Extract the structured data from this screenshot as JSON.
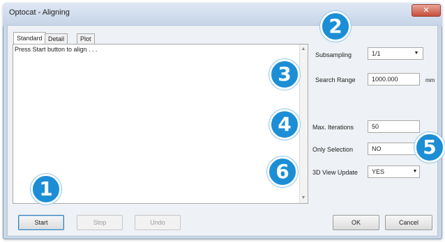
{
  "window": {
    "title": "Optocat - Aligning",
    "close_glyph": "✕"
  },
  "tabs": [
    {
      "label": "Standard",
      "active": true
    },
    {
      "label": "Detail",
      "active": false
    },
    {
      "label": "Plot",
      "active": false
    }
  ],
  "output": {
    "text": "Press Start button to align . . ."
  },
  "form": {
    "subsampling": {
      "label": "Subsampling",
      "value": "1/1"
    },
    "search_range": {
      "label": "Search Range",
      "value": "1000.000",
      "unit": "mm"
    },
    "max_iterations": {
      "label": "Max. Iterations",
      "value": "50"
    },
    "only_selection": {
      "label": "Only Selection",
      "value": "NO"
    },
    "view_update": {
      "label": "3D View Update",
      "value": "YES"
    }
  },
  "buttons": {
    "start": "Start",
    "stop": "Stop",
    "undo": "Undo",
    "ok": "OK",
    "cancel": "Cancel"
  },
  "callouts": [
    "1",
    "2",
    "3",
    "4",
    "5",
    "6"
  ],
  "colors": {
    "callout": "#1b8ed6",
    "title_bar": "#c9d7e8",
    "client_bg": "#eef1f5"
  }
}
